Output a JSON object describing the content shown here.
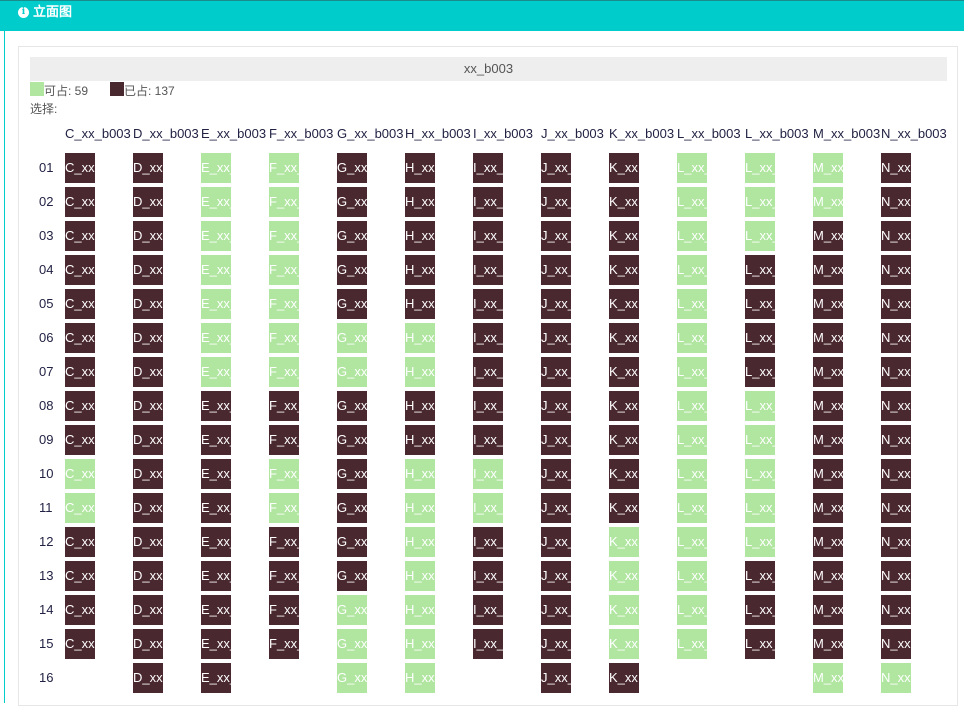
{
  "header": {
    "icon": "info-icon",
    "title": "立面图"
  },
  "caption": "xx_b003",
  "legend": {
    "available": {
      "label": "可占: 59",
      "color": "#b0e6a0"
    },
    "occupied": {
      "label": "已占: 137",
      "color": "#4a2830"
    }
  },
  "select_label": "选择:",
  "columns": [
    "C_xx_b003",
    "D_xx_b003",
    "E_xx_b003",
    "F_xx_b003",
    "G_xx_b003",
    "H_xx_b003",
    "I_xx_b003",
    "J_xx_b003",
    "K_xx_b003",
    "L_xx_b003",
    "L_xx_b003",
    "M_xx_b003",
    "N_xx_b003"
  ],
  "cell_labels": [
    "C_xx",
    "D_xx",
    "E_xx_",
    "F_xx_",
    "G_xx",
    "H_xx",
    "I_xx_",
    "J_xx_",
    "K_xx",
    "L_xx_",
    "L_xx_",
    "M_xx",
    "N_xx"
  ],
  "rows": [
    "01",
    "02",
    "03",
    "04",
    "05",
    "06",
    "07",
    "08",
    "09",
    "10",
    "11",
    "12",
    "13",
    "14",
    "15",
    "16"
  ],
  "grid_legend": {
    "o": "occupied",
    "a": "available",
    "-": "empty"
  },
  "grid": [
    "ooaaoooooaaao",
    "ooaaoooooaaao",
    "ooaaoooooaaoo",
    "ooaaoooooaooo",
    "ooaaoooooaooo",
    "ooaaaaoooaooo",
    "ooaaaaoooaooo",
    "oooooooooaaoo",
    "oooooooooaaoo",
    "aooaoaaooaaoo",
    "aooaoaaooaaoo",
    "oooooaooaaaoo",
    "oooooaooaaooo",
    "ooooaaooaaooo",
    "ooooaaooaaooo",
    "-oo-aa-oo--aa"
  ]
}
